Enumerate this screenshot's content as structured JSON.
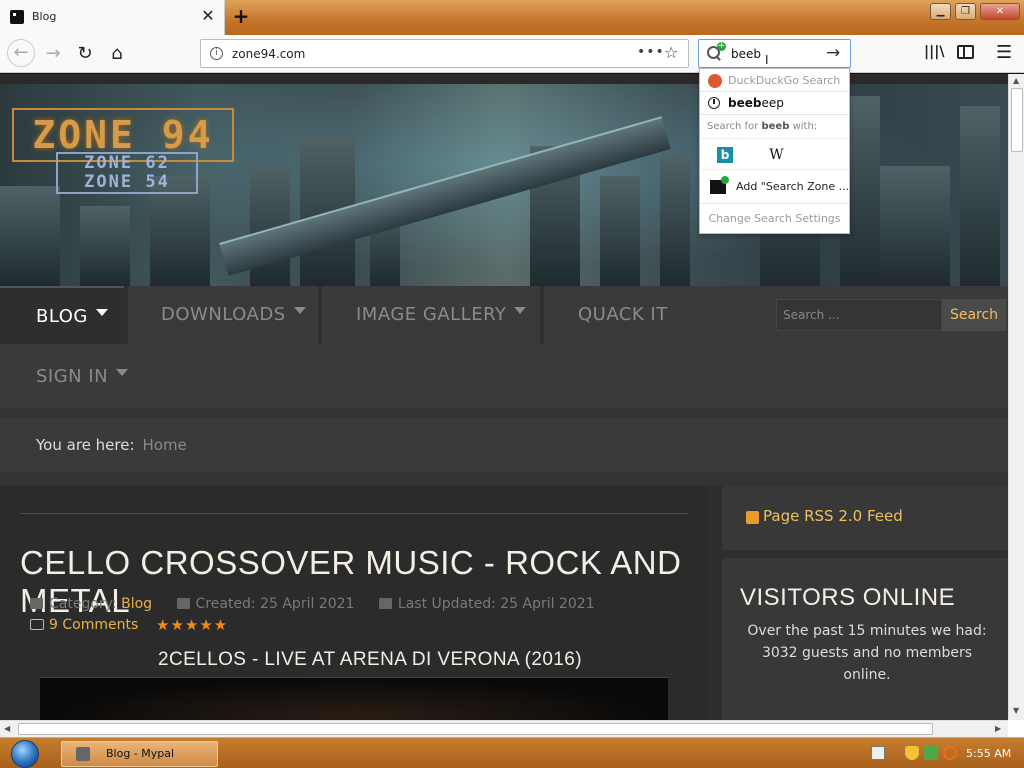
{
  "browser": {
    "tab_title": "Blog",
    "tab_close": "✕",
    "new_tab": "+",
    "url": "zone94.com",
    "page_actions": "•••",
    "bookmark_star": "☆",
    "search_value": "beeb",
    "search_cursor": "I",
    "search_go": "→",
    "back": "←",
    "forward": "→",
    "reload": "↻",
    "home": "⌂",
    "library": "|||\\",
    "menu": "☰",
    "window_min": "▁",
    "window_max": "❐",
    "window_close": "✕"
  },
  "search_dropdown": {
    "engine_name": "DuckDuckGo Search",
    "suggestion_bold": "beeb",
    "suggestion_rest": "eep",
    "search_for_prefix": "Search for",
    "search_for_term": "beeb",
    "search_for_suffix": "with:",
    "bing_glyph": "b",
    "wiki_glyph": "W",
    "add_engine": "Add \"Search Zone ...",
    "change_settings": "Change Search Settings"
  },
  "site": {
    "logo_main": "ZONE 94",
    "logo_sub1": "ZONE 62",
    "logo_sub2": "ZONE 54",
    "nav": {
      "blog": "BLOG",
      "downloads": "DOWNLOADS",
      "gallery": "IMAGE GALLERY",
      "quack": "QUACK IT",
      "signin": "SIGN IN"
    },
    "search_placeholder": "Search ...",
    "search_button": "Search",
    "breadcrumb_label": "You are here:",
    "breadcrumb_home": "Home"
  },
  "article": {
    "title": "CELLO CROSSOVER MUSIC - ROCK AND METAL",
    "category_label": "Category:",
    "category": "Blog",
    "created": "Created: 25 April 2021",
    "updated": "Last Updated: 25 April 2021",
    "comments": "9 Comments",
    "stars": "★★★★★",
    "rating": 5,
    "subheading": "2CELLOS - LIVE AT ARENA DI VERONA (2016)"
  },
  "sidebar": {
    "rss": "Page RSS 2.0 Feed",
    "visitors_title": "VISITORS ONLINE",
    "visitors_text": "Over the past 15 minutes we had: 3032 guests and no members online."
  },
  "scrollbars": {
    "up": "▲",
    "down": "▼",
    "left": "◀",
    "right": "▶"
  },
  "taskbar": {
    "item_label": "Blog - Mypal",
    "clock": "5:55 AM"
  },
  "colors": {
    "accent": "#e8b24a",
    "star": "#f08a1c",
    "taskbar": "#c67d2e"
  }
}
